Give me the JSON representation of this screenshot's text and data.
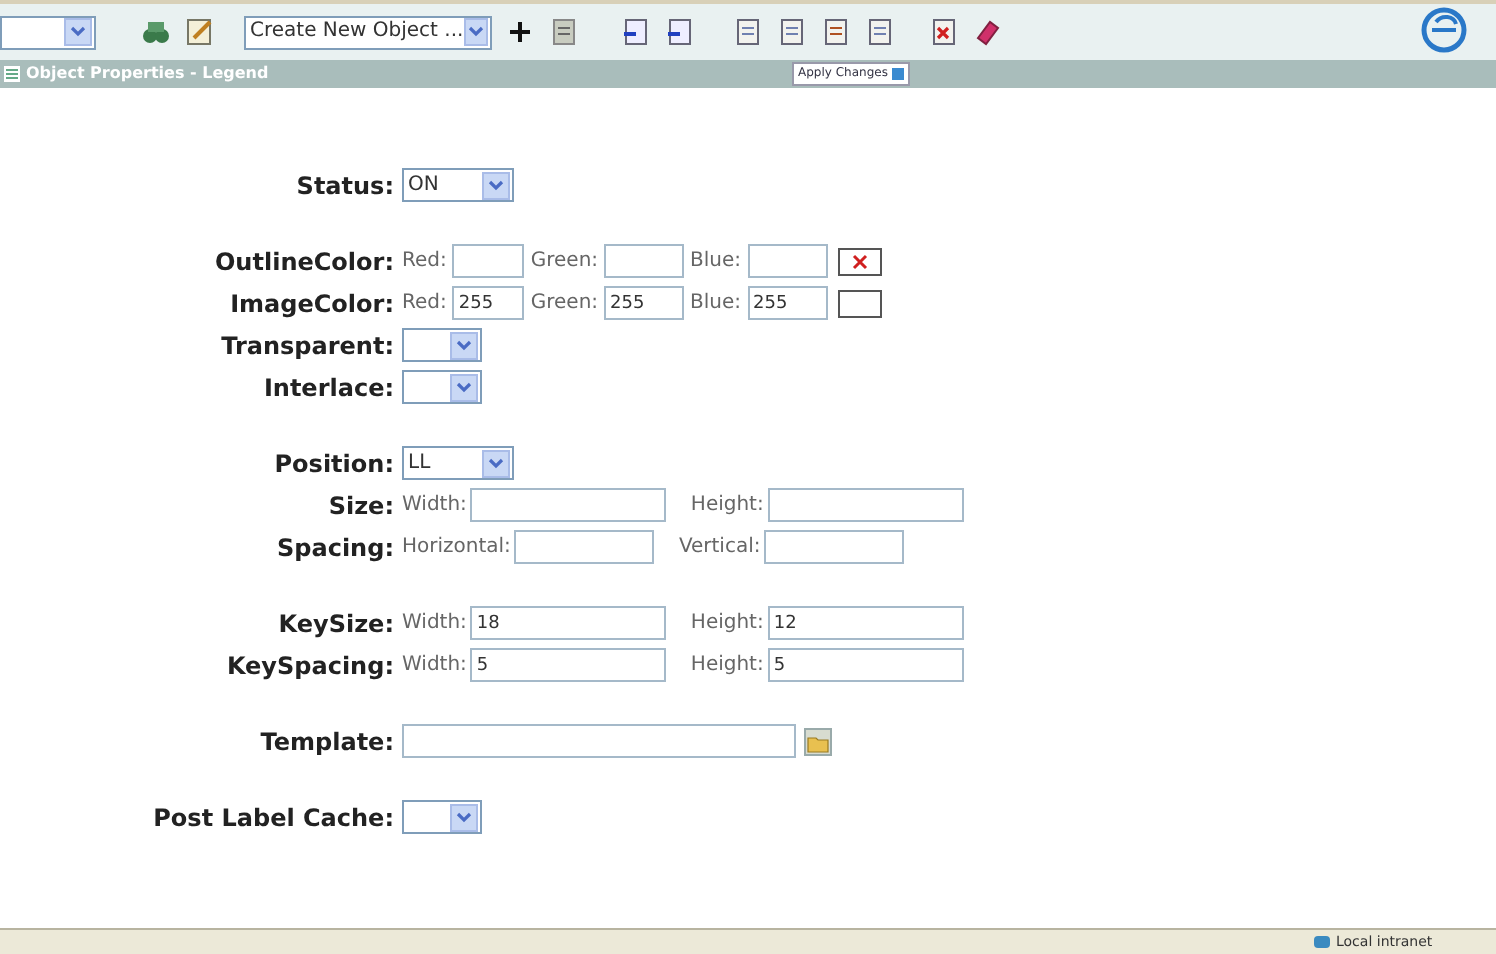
{
  "toolbar": {
    "create_select": {
      "value": "Create New Object ..."
    }
  },
  "panel": {
    "title": "Object Properties - Legend",
    "apply_button": "Apply Changes"
  },
  "sections": [
    [
      {
        "kind": "select",
        "label": "Status:",
        "value": "ON"
      }
    ],
    [
      {
        "kind": "rgb",
        "label": "OutlineColor:",
        "fields": [
          {
            "label": "Red:"
          },
          {
            "label": "Green:"
          },
          {
            "label": "Blue:"
          }
        ],
        "swatch_empty": true
      },
      {
        "kind": "rgb",
        "label": "ImageColor:",
        "fields": [
          {
            "label": "Red:",
            "value": "255"
          },
          {
            "label": "Green:",
            "value": "255"
          },
          {
            "label": "Blue:",
            "value": "255"
          }
        ],
        "swatch_empty": false
      },
      {
        "kind": "select",
        "label": "Transparent:"
      },
      {
        "kind": "select",
        "label": "Interlace:"
      }
    ],
    [
      {
        "kind": "select",
        "label": "Position:",
        "value": "LL"
      },
      {
        "kind": "pair",
        "label": "Size:",
        "fields": [
          {
            "label": "Width:"
          },
          {
            "label": "Height:"
          }
        ]
      },
      {
        "kind": "pair",
        "label": "Spacing:",
        "fields": [
          {
            "label": "Horizontal:"
          },
          {
            "label": "Vertical:"
          }
        ]
      }
    ],
    [
      {
        "kind": "pair",
        "label": "KeySize:",
        "fields": [
          {
            "label": "Width:",
            "value": "18"
          },
          {
            "label": "Height:",
            "value": "12"
          }
        ]
      },
      {
        "kind": "pair",
        "label": "KeySpacing:",
        "fields": [
          {
            "label": "Width:",
            "value": "5"
          },
          {
            "label": "Height:",
            "value": "5"
          }
        ]
      }
    ],
    [
      {
        "kind": "file",
        "label": "Template:"
      }
    ],
    [
      {
        "kind": "select",
        "label": "Post Label Cache:"
      }
    ]
  ],
  "status_bar": {
    "zone": "Local intranet"
  }
}
